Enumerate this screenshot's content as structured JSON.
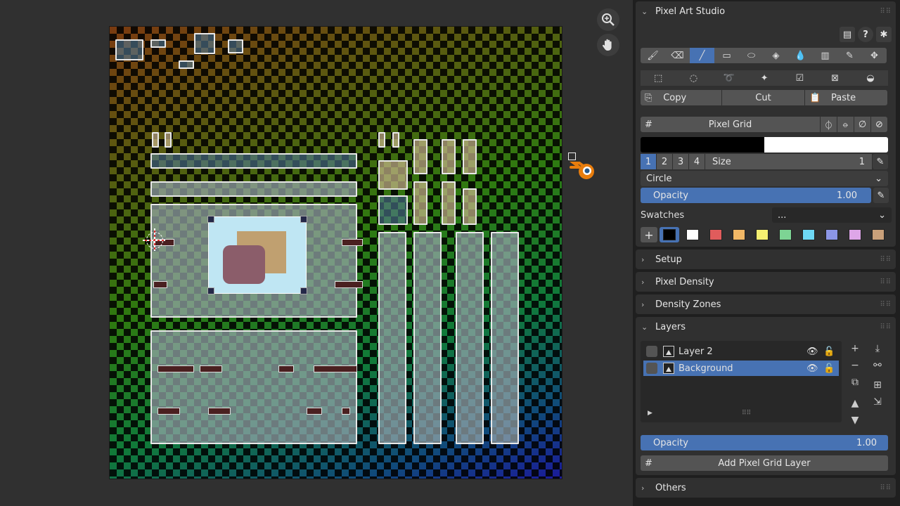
{
  "viewport": {
    "zoom_icon": "zoom-in-icon",
    "pan_icon": "hand-icon"
  },
  "panel": {
    "title": "Pixel Art Studio",
    "header_icons": [
      "book-icon",
      "help-icon",
      "bug-icon"
    ],
    "tools": [
      {
        "name": "brush-icon",
        "glyph": "🖌"
      },
      {
        "name": "eraser-icon",
        "glyph": "⌫"
      },
      {
        "name": "line-icon",
        "glyph": "╱"
      },
      {
        "name": "rectangle-icon",
        "glyph": "▭"
      },
      {
        "name": "ellipse-icon",
        "glyph": "⬭"
      },
      {
        "name": "fill-bucket-icon",
        "glyph": "◈"
      },
      {
        "name": "drop-icon",
        "glyph": "💧"
      },
      {
        "name": "gradient-icon",
        "glyph": "▥"
      },
      {
        "name": "eyedropper-icon",
        "glyph": "✎"
      },
      {
        "name": "move-icon",
        "glyph": "✥"
      }
    ],
    "select_tools": [
      {
        "name": "box-select-icon",
        "glyph": "⬚"
      },
      {
        "name": "circle-select-icon",
        "glyph": "◌"
      },
      {
        "name": "lasso-select-icon",
        "glyph": "➰"
      },
      {
        "name": "magic-wand-icon",
        "glyph": "✦"
      },
      {
        "name": "select-all-icon",
        "glyph": "☑"
      },
      {
        "name": "deselect-icon",
        "glyph": "⊠"
      },
      {
        "name": "invert-select-icon",
        "glyph": "◒"
      }
    ],
    "clipboard": {
      "copy": "Copy",
      "cut": "Cut",
      "paste": "Paste"
    },
    "pixel_grid_label": "Pixel Grid",
    "brush_sizes": [
      "1",
      "2",
      "3",
      "4"
    ],
    "size_label": "Size",
    "size_value": "1",
    "shape": "Circle",
    "opacity_label": "Opacity",
    "opacity_value": "1.00",
    "swatches_label": "Swatches",
    "swatches_value": "...",
    "swatch_colors": [
      "#000000",
      "#ffffff",
      "#e05c5c",
      "#f2b866",
      "#f5f071",
      "#7dd494",
      "#6ed8f5",
      "#8c96e6",
      "#dea6e8",
      "#c9a07a"
    ],
    "primary_color": "#000000",
    "secondary_color": "#ffffff",
    "accent": "#4772b3"
  },
  "sections": {
    "setup": "Setup",
    "pixel_density": "Pixel Density",
    "density_zones": "Density Zones",
    "layers": "Layers",
    "others": "Others"
  },
  "layers": {
    "items": [
      {
        "name": "Layer 2",
        "selected": false
      },
      {
        "name": "Background",
        "selected": true
      }
    ],
    "opacity_label": "Opacity",
    "opacity_value": "1.00",
    "add_grid_label": "Add Pixel Grid Layer"
  }
}
